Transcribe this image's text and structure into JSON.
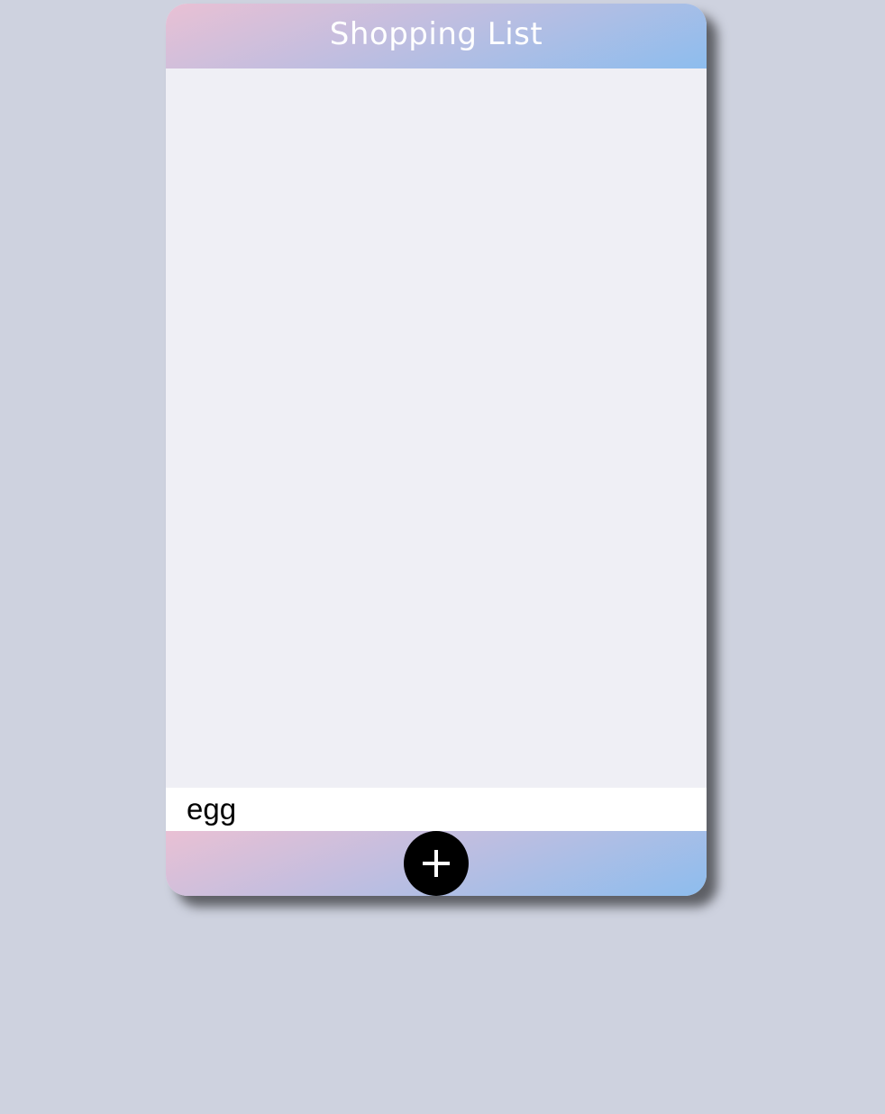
{
  "header": {
    "title": "Shopping List"
  },
  "list": {
    "items": []
  },
  "input": {
    "value": "egg"
  },
  "footer": {
    "add_icon": "plus-icon"
  },
  "colors": {
    "page_background": "#ced2df",
    "list_background": "#efeff5",
    "gradient_start": "#e9c0d4",
    "gradient_mid": "#c0bee0",
    "gradient_end": "#8dbdee",
    "add_button": "#000000"
  }
}
